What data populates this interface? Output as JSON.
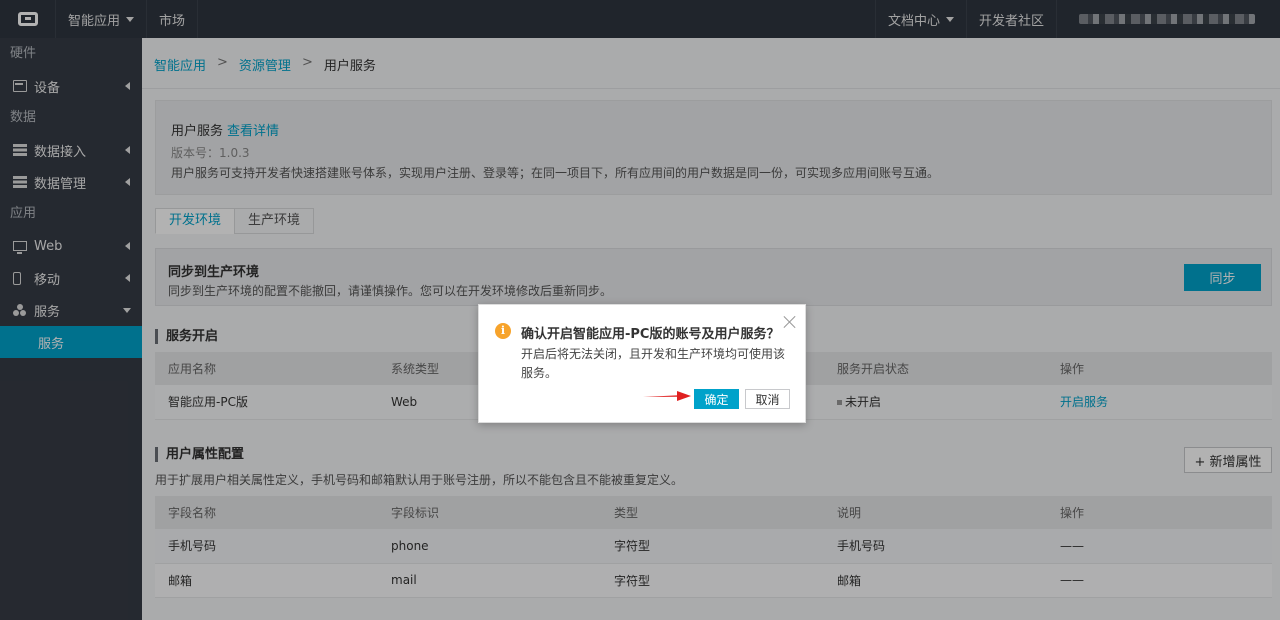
{
  "topbar": {
    "app_menu": "智能应用",
    "market": "市场",
    "docs": "文档中心",
    "community": "开发者社区"
  },
  "sidebar": {
    "groups": [
      "硬件",
      "数据",
      "应用"
    ],
    "items": [
      {
        "label": "设备",
        "icon": "device-icon"
      },
      {
        "label": "数据接入",
        "icon": "database-icon"
      },
      {
        "label": "数据管理",
        "icon": "database-icon"
      },
      {
        "label": "Web",
        "icon": "monitor-icon"
      },
      {
        "label": "移动",
        "icon": "mobile-icon"
      },
      {
        "label": "服务",
        "icon": "service-icon"
      }
    ],
    "active_sub": "服务"
  },
  "breadcrumb": [
    "智能应用",
    "资源管理",
    "用户服务"
  ],
  "info": {
    "title": "用户服务",
    "detail_link": "查看详情",
    "version": "版本号：1.0.3",
    "description": "用户服务可支持开发者快速搭建账号体系，实现用户注册、登录等；在同一项目下，所有应用间的用户数据是同一份，可实现多应用间账号互通。"
  },
  "tabs": [
    "开发环境",
    "生产环境"
  ],
  "sync": {
    "title": "同步到生产环境",
    "description": "同步到生产环境的配置不能撤回，请谨慎操作。您可以在开发环境修改后重新同步。",
    "button": "同步"
  },
  "service_section": {
    "title": "服务开启",
    "columns": [
      "应用名称",
      "系统类型",
      "",
      "服务开启状态",
      "操作"
    ],
    "rows": [
      {
        "name": "智能应用-PC版",
        "type": "Web",
        "status": "未开启",
        "action": "开启服务"
      }
    ]
  },
  "attr_section": {
    "title": "用户属性配置",
    "description": "用于扩展用户相关属性定义，手机号码和邮箱默认用于账号注册，所以不能包含且不能被重复定义。",
    "add_button": "+ 新增属性",
    "columns": [
      "字段名称",
      "字段标识",
      "类型",
      "说明",
      "操作"
    ],
    "rows": [
      [
        "手机号码",
        "phone",
        "字符型",
        "手机号码",
        "——"
      ],
      [
        "邮箱",
        "mail",
        "字符型",
        "邮箱",
        "——"
      ]
    ]
  },
  "dialog": {
    "icon": "warning-icon",
    "title": "确认开启智能应用-PC版的账号及用户服务？",
    "body": "开启后将无法关闭，且开发和生产环境均可使用该服务。",
    "ok": "确定",
    "cancel": "取消"
  },
  "colors": {
    "accent": "#00a2ca",
    "topbar": "#2f3640",
    "sidebar": "#363b45",
    "warning": "#f7a32b",
    "arrow": "#e02020"
  }
}
